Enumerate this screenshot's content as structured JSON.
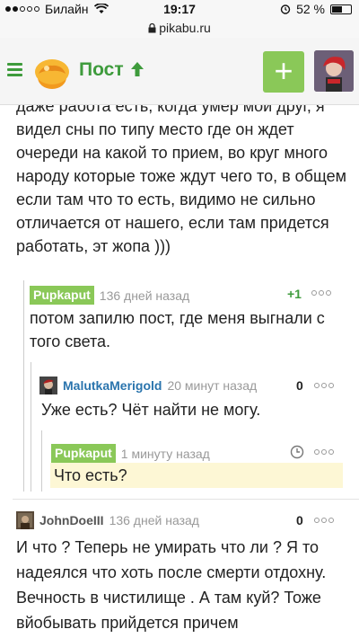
{
  "status_bar": {
    "carrier": "Билайн",
    "time": "19:17",
    "battery": "52 %",
    "battery_level": 0.52,
    "signal_bars": 2
  },
  "url_bar": {
    "url": "pikabu.ru"
  },
  "header": {
    "title": "Пост",
    "title_arrow": "up-arrow-icon",
    "add_label": "+"
  },
  "colors": {
    "accent": "#3e9b3c",
    "button": "#8ac858",
    "link": "#2a74ad",
    "highlight": "#fdf7d5"
  },
  "post_fragment": {
    "text": "даже работа есть, когда умер мой друг, я видел сны по типу место где он ждет очереди на какой то прием, во круг много народу которые тоже ждут чего то, в общем если там что то есть, видимо не сильно отличается от нашего, если там придется работать, эт жопа )))"
  },
  "comments": [
    {
      "author": "Pupkaput",
      "age": "136 дней назад",
      "score": "+1",
      "text": "потом запилю пост, где меня выгнали с того света."
    },
    {
      "author": "MalutkaMerigold",
      "age": "20 минут назад",
      "score": "0",
      "text": "Уже есть? Чёт найти не могу."
    },
    {
      "author": "Pupkaput",
      "age": "1 минуту назад",
      "score": "",
      "text": "Что есть?"
    },
    {
      "author": "JohnDoeIII",
      "age": "136 дней назад",
      "score": "0",
      "text": "И что ? Теперь не умирать что ли ? Я то надеялся что хоть после смерти отдохну. Вечность в чистилище . А там куй? Тоже вйобывать прийдется причем"
    }
  ]
}
